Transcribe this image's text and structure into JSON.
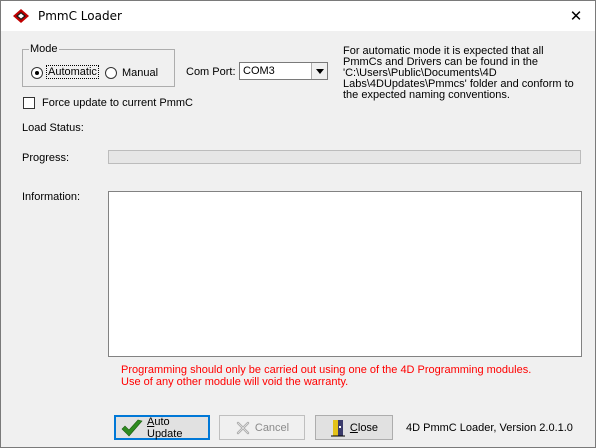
{
  "window": {
    "title": "PmmC Loader",
    "close_glyph": "✕",
    "icon": "4d-logo-icon"
  },
  "mode": {
    "legend": "Mode",
    "options": [
      {
        "label": "Automatic",
        "selected": true
      },
      {
        "label": "Manual",
        "selected": false
      }
    ]
  },
  "com_port": {
    "label": "Com Port:",
    "value": "COM3"
  },
  "force_update": {
    "label": "Force update to current PmmC",
    "checked": false
  },
  "note": "For automatic mode it is expected that all PmmCs and Drivers can be found in the 'C:\\Users\\Public\\Documents\\4D Labs\\4DUpdates\\Pmmcs' folder and conform to the expected naming conventions.",
  "load_status": {
    "label": "Load Status:",
    "value": ""
  },
  "progress": {
    "label": "Progress:",
    "value": 0
  },
  "information": {
    "label": "Information:",
    "text": ""
  },
  "warning": {
    "line1": "Programming should only be carried out using one of the 4D Programming modules.",
    "line2": "Use of any other module will void the warranty."
  },
  "buttons": {
    "auto_update": {
      "mnemonic": "A",
      "rest": "uto Update",
      "icon": "checkmark-icon",
      "enabled": true
    },
    "cancel": {
      "mnemonic": "",
      "rest": "Cancel",
      "icon": "cancel-x-icon",
      "enabled": false
    },
    "close": {
      "mnemonic": "C",
      "rest": "lose",
      "icon": "door-icon",
      "enabled": true
    }
  },
  "version": "4D PmmC Loader, Version 2.0.1.0",
  "colors": {
    "warning": "#ff0000",
    "progress_fill": "#06b025",
    "default_button_border": "#0078d7"
  }
}
